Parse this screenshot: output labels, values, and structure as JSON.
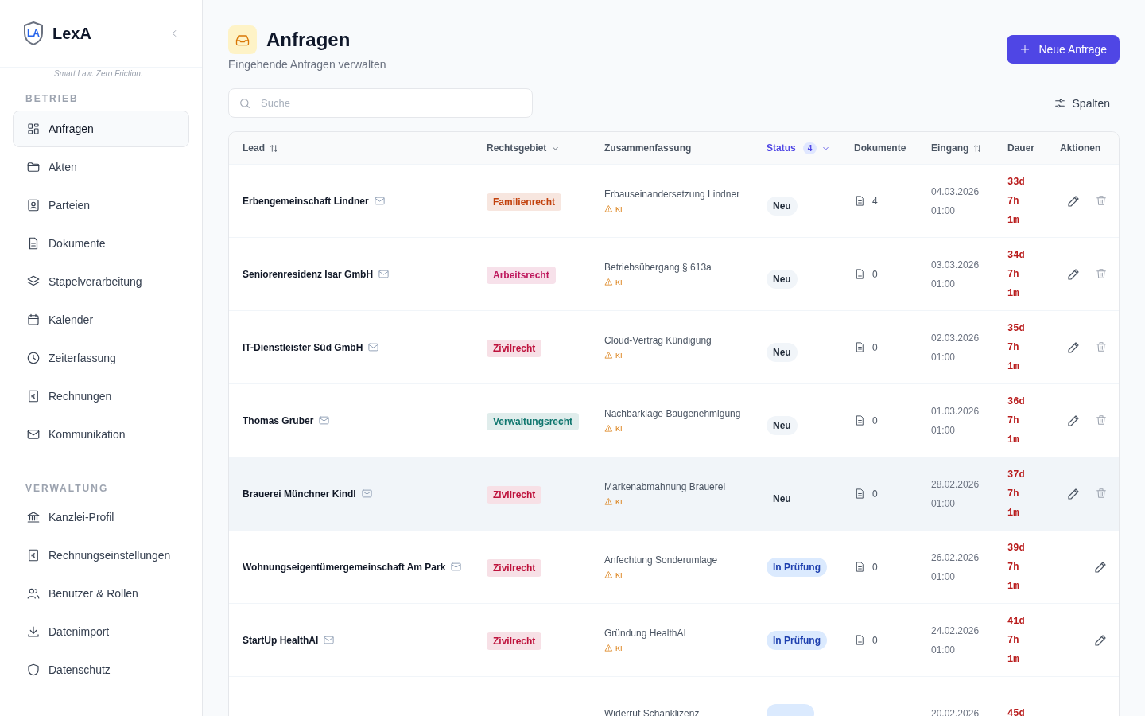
{
  "brand": {
    "name": "LexA",
    "logo_text": "LA",
    "tagline": "Smart Law. Zero Friction."
  },
  "sidebar": {
    "sections": [
      {
        "title": "BETRIEB",
        "items": [
          {
            "label": "Anfragen",
            "selected": true
          },
          {
            "label": "Akten",
            "selected": false
          },
          {
            "label": "Parteien",
            "selected": false
          },
          {
            "label": "Dokumente",
            "selected": false
          },
          {
            "label": "Stapelverarbeitung",
            "selected": false
          },
          {
            "label": "Kalender",
            "selected": false
          },
          {
            "label": "Zeiterfassung",
            "selected": false
          },
          {
            "label": "Rechnungen",
            "selected": false
          },
          {
            "label": "Kommunikation",
            "selected": false
          }
        ]
      },
      {
        "title": "VERWALTUNG",
        "items": [
          {
            "label": "Kanzlei-Profil",
            "selected": false
          },
          {
            "label": "Rechnungseinstellungen",
            "selected": false
          },
          {
            "label": "Benutzer & Rollen",
            "selected": false
          },
          {
            "label": "Datenimport",
            "selected": false
          },
          {
            "label": "Datenschutz",
            "selected": false
          }
        ]
      }
    ]
  },
  "header": {
    "title": "Anfragen",
    "subtitle": "Eingehende Anfragen verwalten",
    "primary_button": "Neue Anfrage"
  },
  "search": {
    "placeholder": "Suche"
  },
  "columns_button": "Spalten",
  "table": {
    "columns": [
      {
        "label": "Lead",
        "kind": "sort",
        "active": false
      },
      {
        "label": "Rechtsgebiet",
        "kind": "filter",
        "active": false
      },
      {
        "label": "Zusammenfassung",
        "kind": "plain",
        "active": false
      },
      {
        "label": "Status",
        "kind": "filter",
        "active": true,
        "count": "4"
      },
      {
        "label": "Dokumente",
        "kind": "plain",
        "active": false
      },
      {
        "label": "Eingang",
        "kind": "sort",
        "active": false
      },
      {
        "label": "Dauer",
        "kind": "plain",
        "active": false
      },
      {
        "label": "Aktionen",
        "kind": "plain",
        "active": false
      }
    ],
    "rows": [
      {
        "lead": "Erbengemeinschaft Lindner",
        "area": {
          "label": "Familienrecht",
          "color": "#c2410c"
        },
        "summary": "Erbauseinandersetzung Lindner",
        "ai": "KI",
        "status": {
          "kind": "new",
          "label": "Neu"
        },
        "documents": "4",
        "date": "04.03.2026",
        "time": "01:00",
        "duration": [
          "33d",
          "7h",
          "1m"
        ],
        "deletable": true,
        "hovered": false
      },
      {
        "lead": "Seniorenresidenz Isar GmbH",
        "area": {
          "label": "Arbeitsrecht",
          "color": "#be185d"
        },
        "summary": "Betriebsübergang § 613a",
        "ai": "KI",
        "status": {
          "kind": "new",
          "label": "Neu"
        },
        "documents": "0",
        "date": "03.03.2026",
        "time": "01:00",
        "duration": [
          "34d",
          "7h",
          "1m"
        ],
        "deletable": true,
        "hovered": false
      },
      {
        "lead": "IT-Dienstleister Süd GmbH",
        "area": {
          "label": "Zivilrecht",
          "color": "#be123c"
        },
        "summary": "Cloud-Vertrag Kündigung",
        "ai": "KI",
        "status": {
          "kind": "new",
          "label": "Neu"
        },
        "documents": "0",
        "date": "02.03.2026",
        "time": "01:00",
        "duration": [
          "35d",
          "7h",
          "1m"
        ],
        "deletable": true,
        "hovered": false
      },
      {
        "lead": "Thomas Gruber",
        "area": {
          "label": "Verwaltungsrecht",
          "color": "#0f766e"
        },
        "summary": "Nachbarklage Baugenehmigung",
        "ai": "KI",
        "status": {
          "kind": "new",
          "label": "Neu"
        },
        "documents": "0",
        "date": "01.03.2026",
        "time": "01:00",
        "duration": [
          "36d",
          "7h",
          "1m"
        ],
        "deletable": true,
        "hovered": false
      },
      {
        "lead": "Brauerei Münchner Kindl",
        "area": {
          "label": "Zivilrecht",
          "color": "#be123c"
        },
        "summary": "Markenabmahnung Brauerei",
        "ai": "KI",
        "status": {
          "kind": "new",
          "label": "Neu"
        },
        "documents": "0",
        "date": "28.02.2026",
        "time": "01:00",
        "duration": [
          "37d",
          "7h",
          "1m"
        ],
        "deletable": true,
        "hovered": true
      },
      {
        "lead": "Wohnungseigentümergemeinschaft Am Park",
        "area": {
          "label": "Zivilrecht",
          "color": "#be123c"
        },
        "summary": "Anfechtung Sonderumlage",
        "ai": "KI",
        "status": {
          "kind": "review",
          "label": "In Prüfung"
        },
        "documents": "0",
        "date": "26.02.2026",
        "time": "01:00",
        "duration": [
          "39d",
          "7h",
          "1m"
        ],
        "deletable": false,
        "hovered": false
      },
      {
        "lead": "StartUp HealthAI",
        "area": {
          "label": "Zivilrecht",
          "color": "#be123c"
        },
        "summary": "Gründung HealthAI",
        "ai": "KI",
        "status": {
          "kind": "review",
          "label": "In Prüfung"
        },
        "documents": "0",
        "date": "24.02.2026",
        "time": "01:00",
        "duration": [
          "41d",
          "7h",
          "1m"
        ],
        "deletable": false,
        "hovered": false
      },
      {
        "summary": "Widerruf Schanklizenz",
        "status": {
          "kind": "review"
        },
        "date": "20.02.2026",
        "duration": [
          "45d"
        ],
        "hovered": false
      }
    ]
  }
}
